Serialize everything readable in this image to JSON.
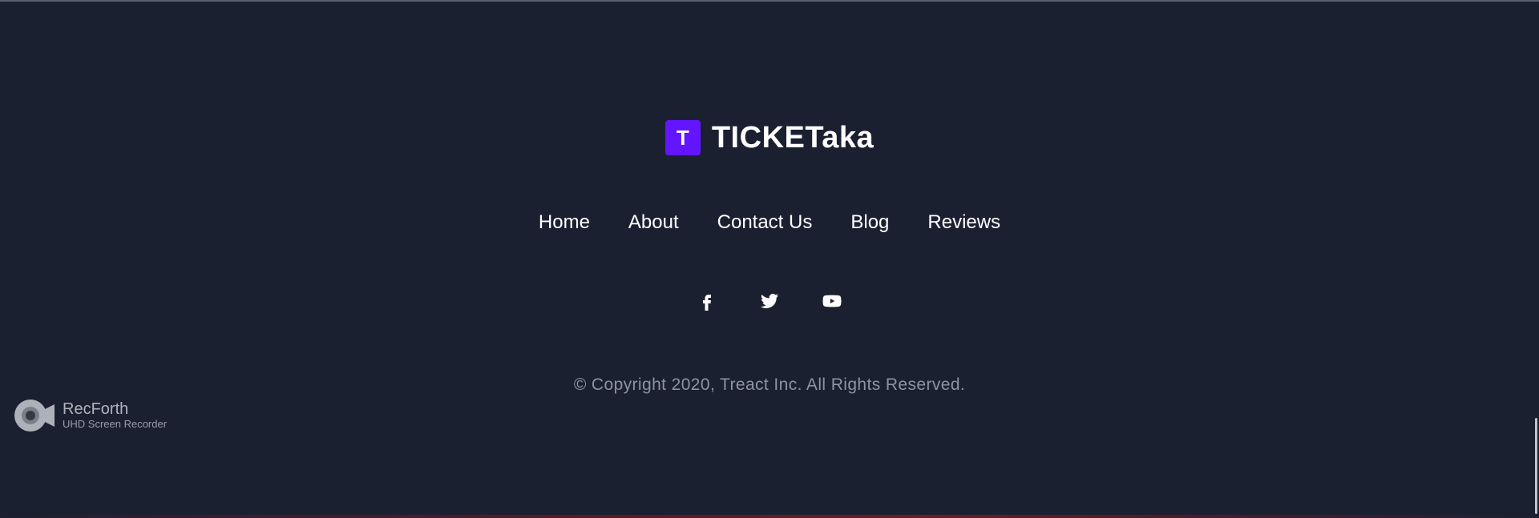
{
  "brand": {
    "mark_letter": "T",
    "name": "TICKETaka",
    "mark_color": "#6415ff"
  },
  "nav": {
    "items": [
      {
        "label": "Home"
      },
      {
        "label": "About"
      },
      {
        "label": "Contact Us"
      },
      {
        "label": "Blog"
      },
      {
        "label": "Reviews"
      }
    ]
  },
  "social": {
    "icons": [
      "facebook-icon",
      "twitter-icon",
      "youtube-icon"
    ]
  },
  "copyright": "© Copyright 2020, Treact Inc. All Rights Reserved.",
  "watermark": {
    "title": "RecForth",
    "subtitle": "UHD Screen Recorder"
  },
  "colors": {
    "background": "#1b2031",
    "text": "#ffffff",
    "muted_text": "#8e93a3",
    "accent": "#6415ff"
  }
}
